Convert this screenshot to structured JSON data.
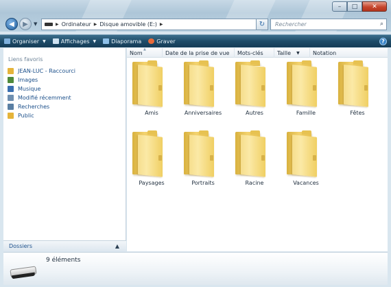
{
  "window": {
    "controls": {
      "minimize": "–",
      "maximize": "□",
      "close": "✕"
    }
  },
  "nav": {
    "back_icon": "arrow-left-icon",
    "forward_icon": "arrow-right-icon",
    "breadcrumb": [
      "Ordinateur",
      "Disque amovible (E:)"
    ],
    "search_placeholder": "Rechercher"
  },
  "toolbar": {
    "items": [
      {
        "label": "Organiser",
        "icon": "organize-icon",
        "has_menu": true
      },
      {
        "label": "Affichages",
        "icon": "views-icon",
        "has_menu": true
      },
      {
        "label": "Diaporama",
        "icon": "slideshow-icon",
        "has_menu": false
      },
      {
        "label": "Graver",
        "icon": "burn-icon",
        "has_menu": false
      }
    ]
  },
  "sidebar": {
    "header": "Liens favoris",
    "items": [
      {
        "label": "JEAN-LUC - Raccourci",
        "icon": "folder-shortcut-icon",
        "color": "#e5b43a"
      },
      {
        "label": "Images",
        "icon": "pictures-icon",
        "color": "#4f8a3b"
      },
      {
        "label": "Musique",
        "icon": "music-icon",
        "color": "#3a6fb0"
      },
      {
        "label": "Modifié récemment",
        "icon": "recent-icon",
        "color": "#6f8fb0"
      },
      {
        "label": "Recherches",
        "icon": "searches-icon",
        "color": "#5a7fa3"
      },
      {
        "label": "Public",
        "icon": "public-folder-icon",
        "color": "#e5b43a"
      }
    ],
    "folders_label": "Dossiers"
  },
  "columns": [
    "Nom",
    "Date de la prise de vue",
    "Mots-clés",
    "Taille",
    "Notation"
  ],
  "folders": [
    {
      "name": "Amis",
      "has_photo": false
    },
    {
      "name": "Anniversaires",
      "has_photo": false
    },
    {
      "name": "Autres",
      "has_photo": true
    },
    {
      "name": "Famille",
      "has_photo": false
    },
    {
      "name": "Fêtes",
      "has_photo": false
    },
    {
      "name": "Paysages",
      "has_photo": false
    },
    {
      "name": "Portraits",
      "has_photo": false
    },
    {
      "name": "Racine",
      "has_photo": false
    },
    {
      "name": "Vacances",
      "has_photo": false
    }
  ],
  "details": {
    "count_text": "9 éléments",
    "icon": "removable-drive-icon"
  }
}
